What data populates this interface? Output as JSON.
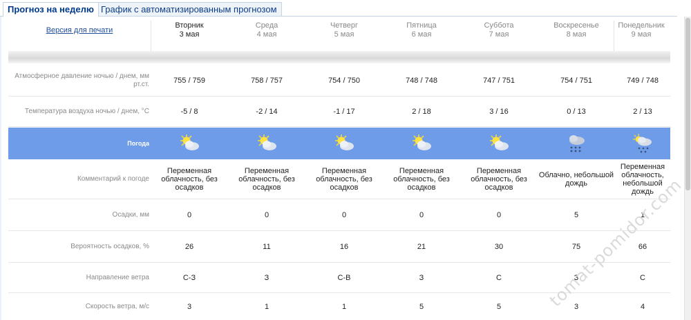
{
  "tabs": [
    {
      "label": "Прогноз на неделю"
    },
    {
      "label": "График с автоматизированным прогнозом"
    }
  ],
  "print_link": "Версия для печати",
  "days": [
    {
      "weekday": "Вторник",
      "date": "3 мая"
    },
    {
      "weekday": "Среда",
      "date": "4 мая"
    },
    {
      "weekday": "Четверг",
      "date": "5 мая"
    },
    {
      "weekday": "Пятница",
      "date": "6 мая"
    },
    {
      "weekday": "Суббота",
      "date": "7 мая"
    },
    {
      "weekday": "Воскресенье",
      "date": "8 мая"
    },
    {
      "weekday": "Понедельник",
      "date": "9 мая"
    }
  ],
  "rows": {
    "pressure": {
      "label": "Атмосферное давление ночью / днем, мм рт.ст.",
      "values": [
        "755 / 759",
        "758 / 757",
        "754 / 750",
        "748 / 748",
        "747 / 751",
        "754 / 751",
        "749 / 748"
      ]
    },
    "temperature": {
      "label": "Температура воздуха ночью / днем, °С",
      "values": [
        "-5 / 8",
        "-2 / 14",
        "-1 / 17",
        "2 / 18",
        "3 / 16",
        "0 / 13",
        "2 / 13"
      ]
    },
    "weather": {
      "label": "Погода",
      "icons": [
        "sun-cloud-icon",
        "sun-cloud-icon",
        "sun-cloud-icon",
        "sun-cloud-icon",
        "sun-cloud-icon",
        "cloud-rain-icon",
        "sun-cloud-rain-icon"
      ]
    },
    "comment": {
      "label": "Комментарий к погоде",
      "values": [
        "Переменная облачность, без осадков",
        "Переменная облачность, без осадков",
        "Переменная облачность, без осадков",
        "Переменная облачность, без осадков",
        "Переменная облачность, без осадков",
        "Облачно, небольшой дождь",
        "Переменная облачность, небольшой дождь"
      ]
    },
    "precip": {
      "label": "Осадки, мм",
      "values": [
        "0",
        "0",
        "0",
        "0",
        "0",
        "5",
        "1"
      ]
    },
    "precip_prob": {
      "label": "Вероятность осадков, %",
      "values": [
        "26",
        "11",
        "16",
        "21",
        "30",
        "75",
        "66"
      ]
    },
    "wind_dir": {
      "label": "Направление ветра",
      "values": [
        "С-З",
        "З",
        "С-В",
        "З",
        "С",
        "З",
        "С"
      ]
    },
    "wind_speed": {
      "label": "Скорость ветра, м/с",
      "values": [
        "3",
        "1",
        "1",
        "5",
        "5",
        "3",
        "4"
      ]
    }
  },
  "colors": {
    "weather_row": "#6f9ce8",
    "tab_text": "#003a8c",
    "link": "#1f4e9b"
  },
  "watermark": "tomat-pomidor.com"
}
